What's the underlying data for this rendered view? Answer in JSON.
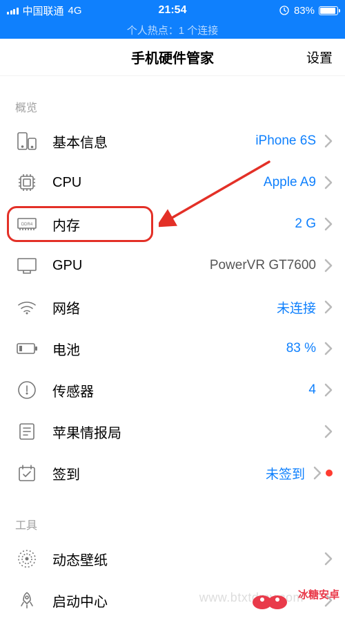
{
  "status_bar": {
    "carrier": "中国联通",
    "network": "4G",
    "time": "21:54",
    "battery_percent": "83%"
  },
  "hotspot": {
    "text": "个人热点：1 个连接"
  },
  "nav": {
    "title": "手机硬件管家",
    "settings": "设置"
  },
  "sections": {
    "overview": "概览",
    "tools": "工具"
  },
  "rows": {
    "basic_info": {
      "label": "基本信息",
      "value": "iPhone 6S"
    },
    "cpu": {
      "label": "CPU",
      "value": "Apple A9"
    },
    "memory": {
      "label": "内存",
      "value": "2 G"
    },
    "gpu": {
      "label": "GPU",
      "value": "PowerVR GT7600"
    },
    "network": {
      "label": "网络",
      "value": "未连接"
    },
    "battery": {
      "label": "电池",
      "value": "83 %"
    },
    "sensors": {
      "label": "传感器",
      "value": "4"
    },
    "intel": {
      "label": "苹果情报局",
      "value": ""
    },
    "checkin": {
      "label": "签到",
      "value": "未签到"
    },
    "wallpaper": {
      "label": "动态壁纸",
      "value": ""
    },
    "launch": {
      "label": "启动中心",
      "value": ""
    }
  },
  "watermark": {
    "domain": "www.btxtdmy.com",
    "brand_top": "冰糖安卓网"
  }
}
